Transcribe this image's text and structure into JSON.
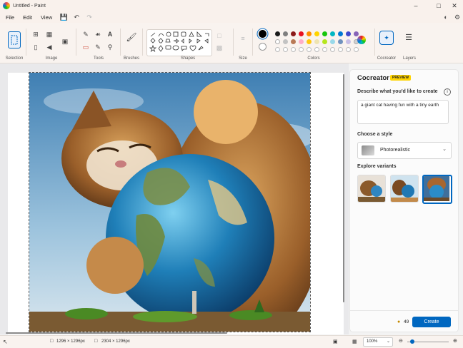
{
  "window": {
    "title": "Untitled - Paint"
  },
  "menu": {
    "file": "File",
    "edit": "Edit",
    "view": "View"
  },
  "ribbon": {
    "groups": {
      "selection": "Selection",
      "image": "Image",
      "tools": "Tools",
      "brushes": "Brushes",
      "shapes": "Shapes",
      "size": "Size",
      "colors": "Colors",
      "cocreator": "Cocreator",
      "layers": "Layers"
    },
    "palette_row1": [
      "#1a1a1a",
      "#7f7f7f",
      "#8b1a1a",
      "#e81123",
      "#ff8c00",
      "#ffd400",
      "#16c60c",
      "#00b7c3",
      "#0078d4",
      "#3f48cc",
      "#8764b8"
    ],
    "palette_row2": [
      "#ffffff",
      "#c3c3c3",
      "#b97a57",
      "#ffaec9",
      "#ffc90e",
      "#efe4b0",
      "#b5e61d",
      "#99d9ea",
      "#7092be",
      "#c8bfe7",
      "#d0d0d0"
    ],
    "primary_color": "#000000",
    "secondary_color": "#ffffff"
  },
  "cocreator": {
    "title": "Cocreator",
    "badge": "PREVIEW",
    "describe_label": "Describe what you'd like to create",
    "prompt": "a giant cat having fun with a tiny earth",
    "style_label": "Choose a style",
    "style_value": "Photorealistic",
    "variants_label": "Explore variants",
    "credits": "49",
    "create_label": "Create"
  },
  "status": {
    "selection_size": "1296 × 1296px",
    "canvas_size": "2304 × 1296px",
    "zoom": "100%"
  }
}
